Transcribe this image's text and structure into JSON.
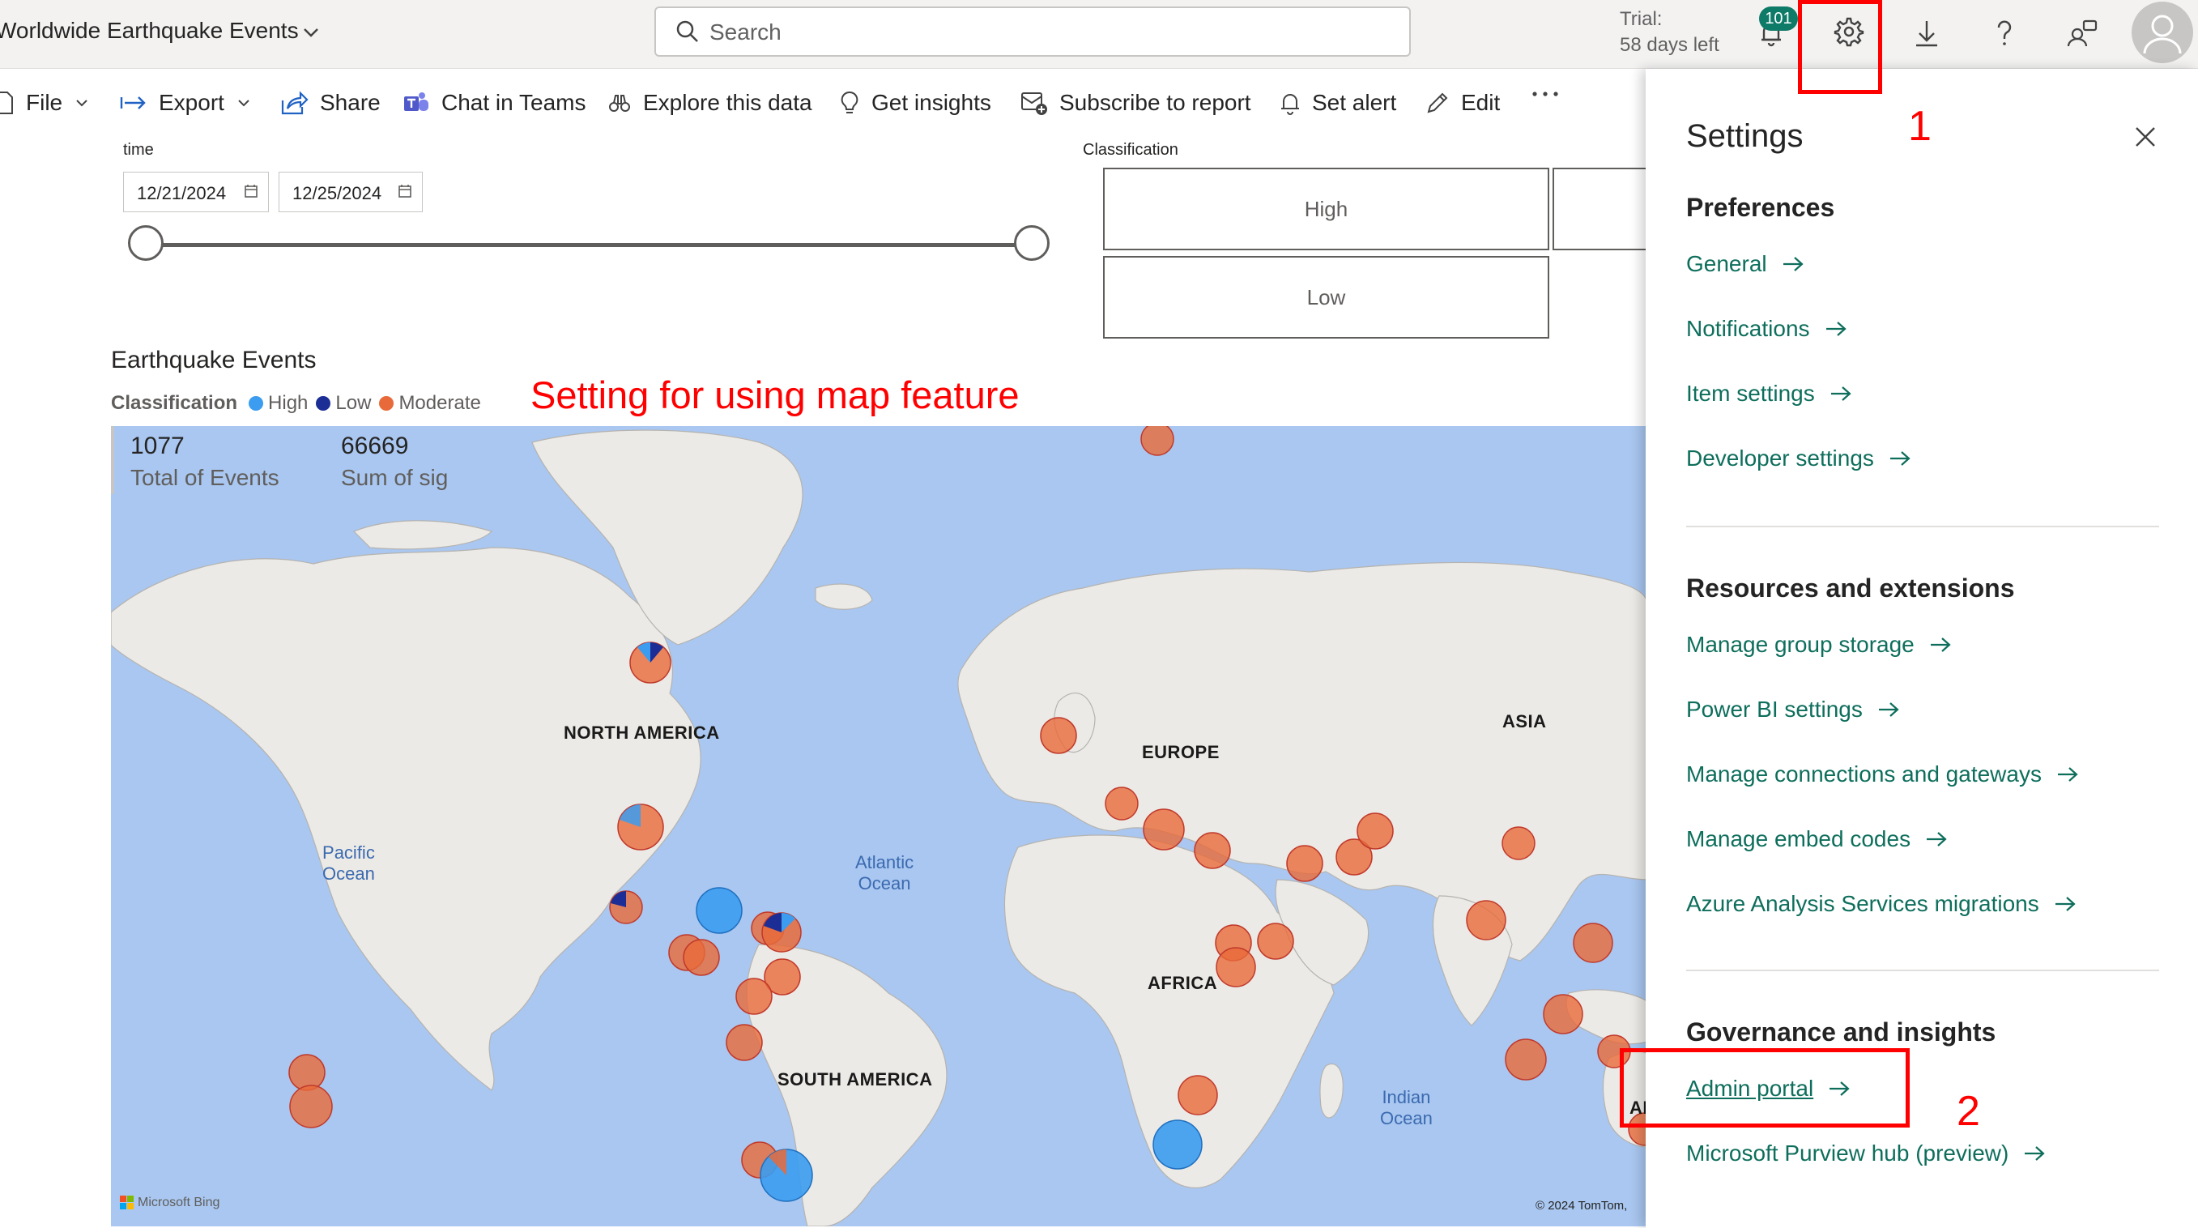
{
  "header": {
    "report_title": "Worldwide Earthquake Events",
    "search_placeholder": "Search",
    "trial_line1": "Trial:",
    "trial_line2": "58 days left",
    "notification_count": "101"
  },
  "toolbar": {
    "file": "File",
    "export": "Export",
    "share": "Share",
    "chat_in_teams": "Chat in Teams",
    "explore": "Explore this data",
    "insights": "Get insights",
    "subscribe": "Subscribe to report",
    "alert": "Set alert",
    "edit": "Edit"
  },
  "filters": {
    "time_label": "time",
    "start_date": "12/21/2024",
    "end_date": "12/25/2024",
    "classification_label": "Classification",
    "options": [
      "High",
      "Low"
    ]
  },
  "map_visual": {
    "title": "Earthquake Events",
    "legend_title": "Classification",
    "legend": [
      {
        "label": "High",
        "color": "#3b9cf0"
      },
      {
        "label": "Low",
        "color": "#1c2d95"
      },
      {
        "label": "Moderate",
        "color": "#e86a3a"
      }
    ],
    "kpis": [
      {
        "value": "1077",
        "label": "Total of Events"
      },
      {
        "value": "66669",
        "label": "Sum of sig"
      }
    ],
    "continent_labels": {
      "north_america": "NORTH AMERICA",
      "south_america": "SOUTH AMERICA",
      "europe": "EUROPE",
      "africa": "AFRICA",
      "asia": "ASIA",
      "australia_fragment": "AI"
    },
    "ocean_labels": {
      "pacific_1": "Pacific",
      "pacific_2": "Ocean",
      "atlantic_1": "Atlantic",
      "atlantic_2": "Ocean",
      "indian_1": "Indian",
      "indian_2": "Ocean"
    },
    "attribution_bing": "Microsoft Bing",
    "attribution_tomtom": "© 2024 TomTom, "
  },
  "settings": {
    "title": "Settings",
    "sections": [
      {
        "heading": "Preferences",
        "links": [
          "General",
          "Notifications",
          "Item settings",
          "Developer settings"
        ]
      },
      {
        "heading": "Resources and extensions",
        "links": [
          "Manage group storage",
          "Power BI settings",
          "Manage connections and gateways",
          "Manage embed codes",
          "Azure Analysis Services migrations"
        ]
      },
      {
        "heading": "Governance and insights",
        "links": [
          "Admin portal",
          "Microsoft Purview hub (preview)"
        ]
      }
    ]
  },
  "annotations": {
    "map_note": "Setting for using map feature",
    "step1": "1",
    "step2": "2"
  }
}
